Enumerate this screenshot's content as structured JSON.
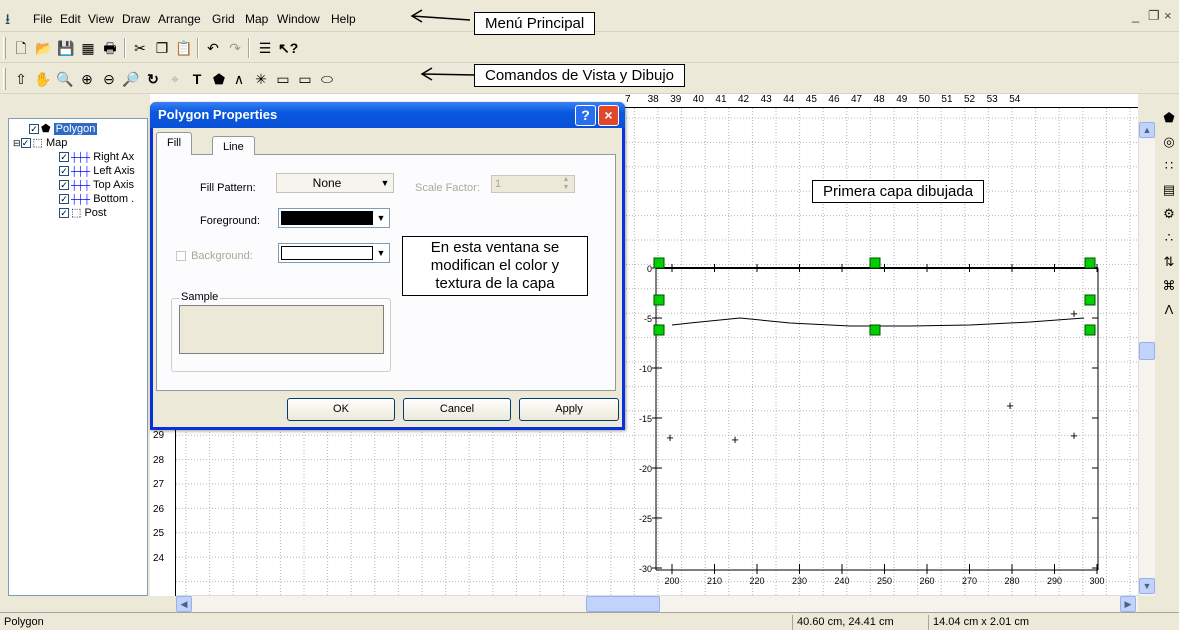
{
  "menubar": {
    "items": [
      "File",
      "Edit",
      "View",
      "Draw",
      "Arrange",
      "Grid",
      "Map",
      "Window",
      "Help"
    ],
    "window_controls": [
      "_",
      "❐",
      "×"
    ]
  },
  "annotations": {
    "main_menu": "Menú Principal",
    "view_draw": "Comandos de Vista y Dibujo",
    "first_layer": "Primera capa dibujada",
    "dialog_note": "En esta ventana se modifican el color y textura de la capa"
  },
  "toolbar1": {
    "icons": [
      "new-icon",
      "open-icon",
      "save-icon",
      "table-icon",
      "print-icon",
      "cut-icon",
      "copy-icon",
      "paste-icon",
      "undo-icon",
      "redo-icon",
      "tree-icon",
      "help-pointer-icon"
    ]
  },
  "toolbar2": {
    "icons": [
      "select-icon",
      "pan-icon",
      "zoom-icon",
      "zoom-in-icon",
      "zoom-out-icon",
      "zoom-page-icon",
      "rotate-icon",
      "reshape-icon",
      "text-icon",
      "polygon-icon",
      "polyline-icon",
      "symbol-icon",
      "rectangle-icon",
      "rounded-rect-icon",
      "ellipse-icon"
    ]
  },
  "tree": {
    "items": [
      {
        "label": "Polygon",
        "selected": true,
        "level": 0
      },
      {
        "label": "Map",
        "level": 0
      },
      {
        "label": "Right Ax",
        "level": 1
      },
      {
        "label": "Left Axis",
        "level": 1
      },
      {
        "label": "Top Axis",
        "level": 1
      },
      {
        "label": "Bottom .",
        "level": 1
      },
      {
        "label": "Post",
        "level": 1
      }
    ]
  },
  "ruler": {
    "top": [
      "7",
      "38",
      "39",
      "40",
      "41",
      "42",
      "43",
      "44",
      "45",
      "46",
      "47",
      "48",
      "49",
      "50",
      "51",
      "52",
      "53",
      "54"
    ],
    "left": [
      "29",
      "28",
      "27",
      "26",
      "25",
      "24"
    ]
  },
  "plot": {
    "y_ticks": [
      "0",
      "-5",
      "-10",
      "-15",
      "-20",
      "-25",
      "-30"
    ],
    "x_ticks": [
      "200",
      "210",
      "220",
      "230",
      "240",
      "250",
      "260",
      "270",
      "280",
      "290",
      "300"
    ]
  },
  "dialog": {
    "title": "Polygon Properties",
    "help_button": "?",
    "close_button": "×",
    "tabs": [
      "Fill",
      "Line"
    ],
    "fill_pattern_label": "Fill Pattern:",
    "fill_pattern_value": "None",
    "scale_factor_label": "Scale Factor:",
    "scale_factor_value": "1",
    "foreground_label": "Foreground:",
    "background_label": "Background:",
    "sample_label": "Sample",
    "ok": "OK",
    "cancel": "Cancel",
    "apply": "Apply"
  },
  "status": {
    "left": "Polygon",
    "coords": "40.60 cm, 24.41 cm",
    "size": "14.04 cm x 2.01 cm"
  },
  "colors": {
    "title_bar": "#0a58e0",
    "handle": "#00d000",
    "foreground": "#000000",
    "background": "#ffffff"
  }
}
